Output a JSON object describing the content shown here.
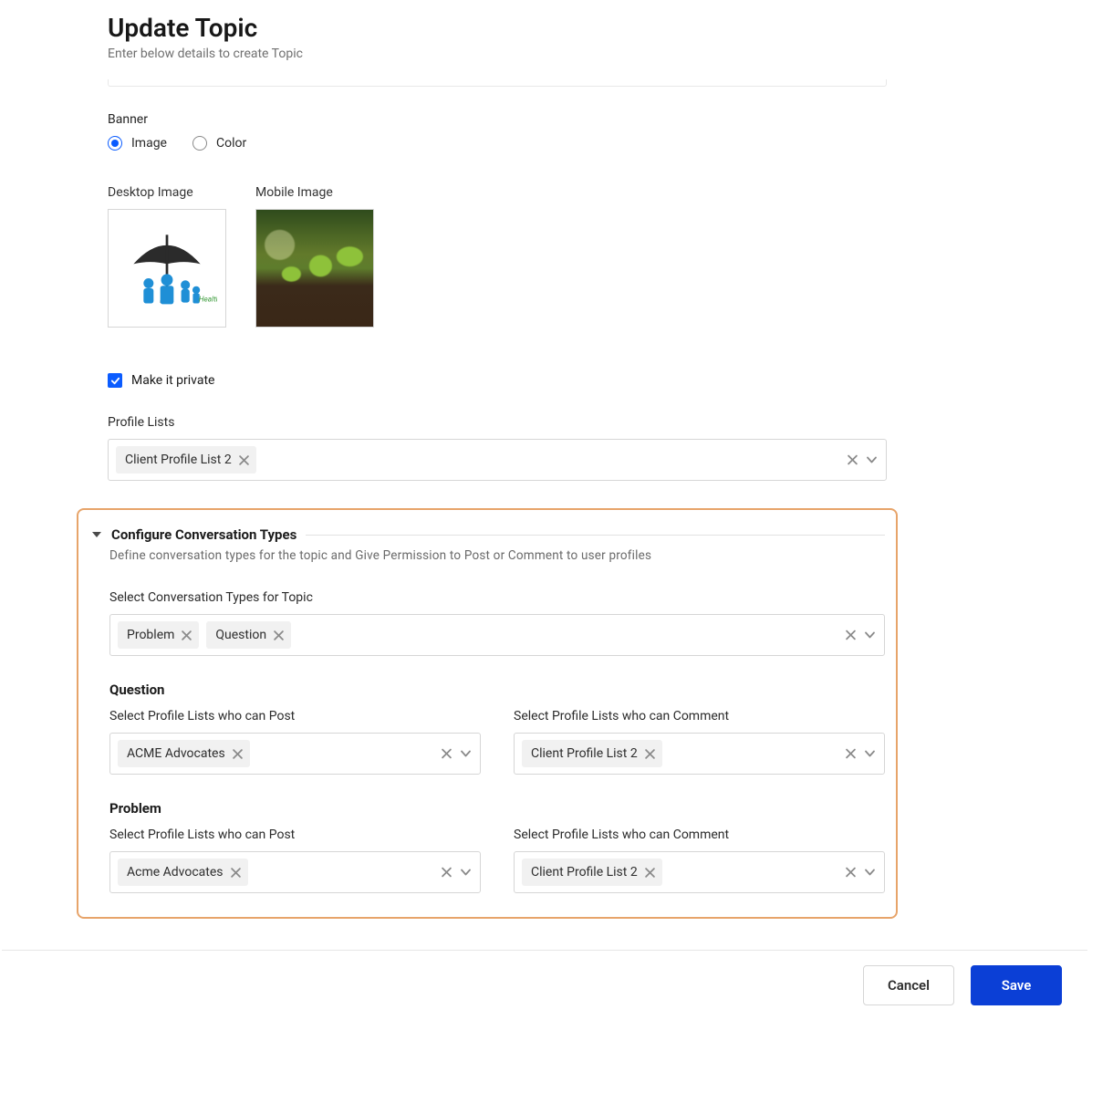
{
  "page": {
    "title": "Update Topic",
    "subtitle": "Enter below details to create Topic"
  },
  "banner": {
    "label": "Banner",
    "options": {
      "image": "Image",
      "color": "Color"
    },
    "selected": "image",
    "desktop_label": "Desktop Image",
    "mobile_label": "Mobile Image",
    "desktop_alt": "Health & Care umbrella illustration",
    "desktop_caption": "Health & C",
    "mobile_alt": "Plants sprouting from soil"
  },
  "privacy": {
    "label": "Make it private",
    "checked": true
  },
  "profile_lists": {
    "label": "Profile Lists",
    "tags": [
      "Client Profile List 2"
    ]
  },
  "conversation": {
    "title": "Configure Conversation Types",
    "subtitle": "Define conversation types for the topic and Give Permission to Post or Comment to user profiles",
    "select_label": "Select Conversation Types for Topic",
    "types": [
      "Problem",
      "Question"
    ],
    "groups": [
      {
        "name": "Question",
        "post_label": "Select Profile Lists who can Post",
        "post_tags": [
          "ACME Advocates"
        ],
        "comment_label": "Select Profile Lists who can Comment",
        "comment_tags": [
          "Client Profile List 2"
        ]
      },
      {
        "name": "Problem",
        "post_label": "Select Profile Lists who can Post",
        "post_tags": [
          "Acme Advocates"
        ],
        "comment_label": "Select Profile Lists who can Comment",
        "comment_tags": [
          "Client Profile List 2"
        ]
      }
    ]
  },
  "footer": {
    "cancel": "Cancel",
    "save": "Save"
  }
}
